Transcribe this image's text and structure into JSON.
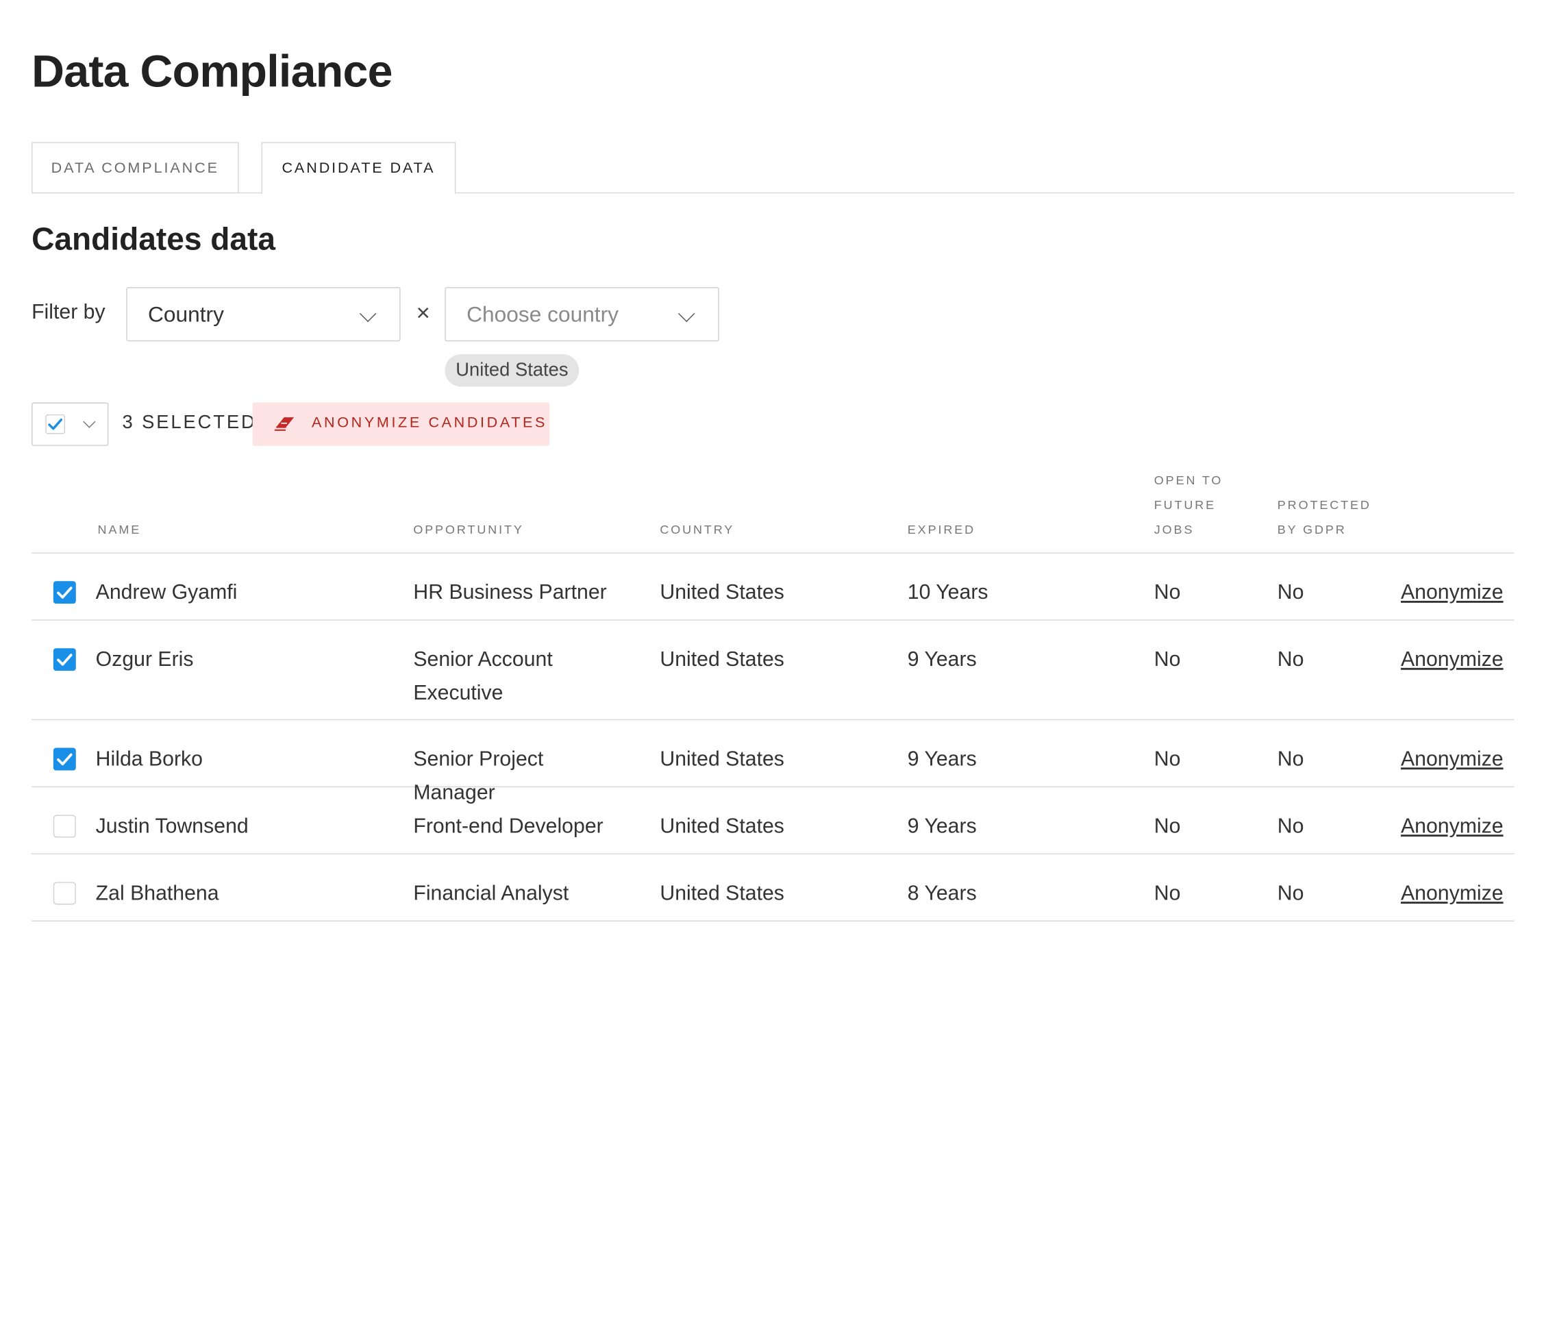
{
  "page": {
    "title": "Data Compliance"
  },
  "tabs": [
    {
      "label": "DATA COMPLIANCE"
    },
    {
      "label": "CANDIDATE DATA"
    }
  ],
  "section": {
    "title": "Candidates data"
  },
  "filter": {
    "label": "Filter by",
    "field_value": "Country",
    "value_placeholder": "Choose country",
    "clear": "×",
    "chips": [
      "United States"
    ]
  },
  "bulk": {
    "selected_text": "3 SELECTED",
    "anonymize_label": "ANONYMIZE CANDIDATES"
  },
  "table": {
    "headers": {
      "name": "NAME",
      "opportunity": "OPPORTUNITY",
      "country": "COUNTRY",
      "expired": "EXPIRED",
      "open_line1": "OPEN TO",
      "open_line2": "FUTURE",
      "open_line3": "JOBS",
      "gdpr_line1": "PROTECTED",
      "gdpr_line2": "BY GDPR"
    },
    "rows": [
      {
        "checked": true,
        "name": "Andrew Gyamfi",
        "opportunity": "HR Business Partner",
        "country": "United States",
        "expired": "10 Years",
        "open": "No",
        "gdpr": "No",
        "action": "Anonymize"
      },
      {
        "checked": true,
        "name": "Ozgur Eris",
        "opportunity": "Senior Account Executive",
        "country": "United States",
        "expired": "9 Years",
        "open": "No",
        "gdpr": "No",
        "action": "Anonymize"
      },
      {
        "checked": true,
        "name": "Hilda Borko",
        "opportunity": "Senior Project Manager",
        "country": "United States",
        "expired": "9 Years",
        "open": "No",
        "gdpr": "No",
        "action": "Anonymize"
      },
      {
        "checked": false,
        "name": "Justin Townsend",
        "opportunity": "Front-end Developer",
        "country": "United States",
        "expired": "9 Years",
        "open": "No",
        "gdpr": "No",
        "action": "Anonymize"
      },
      {
        "checked": false,
        "name": "Zal Bhathena",
        "opportunity": "Financial Analyst",
        "country": "United States",
        "expired": "8 Years",
        "open": "No",
        "gdpr": "No",
        "action": "Anonymize"
      }
    ]
  },
  "colors": {
    "accent": "#1a8fe8",
    "danger_text": "#b3261e",
    "danger_bg": "#fde3e3"
  },
  "icons": {
    "checkbox": "checkmark-icon",
    "eraser": "eraser-icon",
    "chevron": "chevron-down-icon"
  }
}
